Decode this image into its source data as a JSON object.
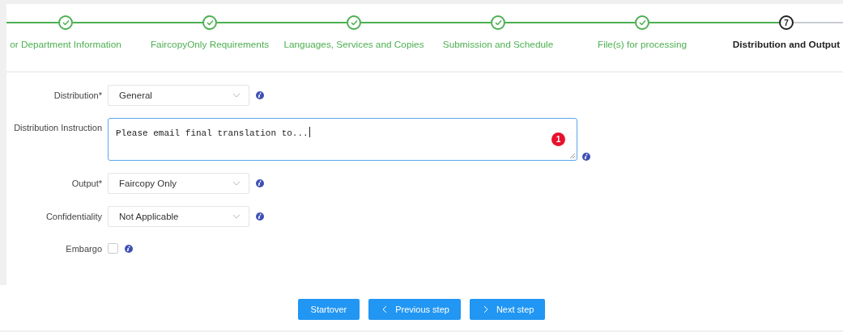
{
  "steps": [
    {
      "label": "or Department Information",
      "completed": true,
      "selected": false
    },
    {
      "label": "FaircopyOnly Requirements",
      "completed": true,
      "selected": false
    },
    {
      "label": "Languages, Services and Copies",
      "completed": true,
      "selected": false
    },
    {
      "label": "Submission and Schedule",
      "completed": true,
      "selected": false
    },
    {
      "label": "File(s) for processing",
      "completed": true,
      "selected": false
    },
    {
      "label": "Distribution and Output",
      "completed": false,
      "selected": true,
      "number": "7"
    }
  ],
  "fields": [
    {
      "kind": "select",
      "label": "Distribution*",
      "value": "General"
    },
    {
      "kind": "textarea",
      "label": "Distribution Instruction",
      "value": "Please email final translation to...",
      "badge": "1"
    },
    {
      "kind": "select",
      "label": "Output*",
      "value": "Faircopy Only"
    },
    {
      "kind": "select",
      "label": "Confidentiality",
      "value": "Not Applicable"
    },
    {
      "kind": "checkbox",
      "label": "Embargo",
      "checked": false
    }
  ],
  "buttons": [
    {
      "label": "Startover",
      "kind": "plain"
    },
    {
      "label": "Previous step",
      "kind": "back"
    },
    {
      "label": "Next step",
      "kind": "forward"
    }
  ]
}
